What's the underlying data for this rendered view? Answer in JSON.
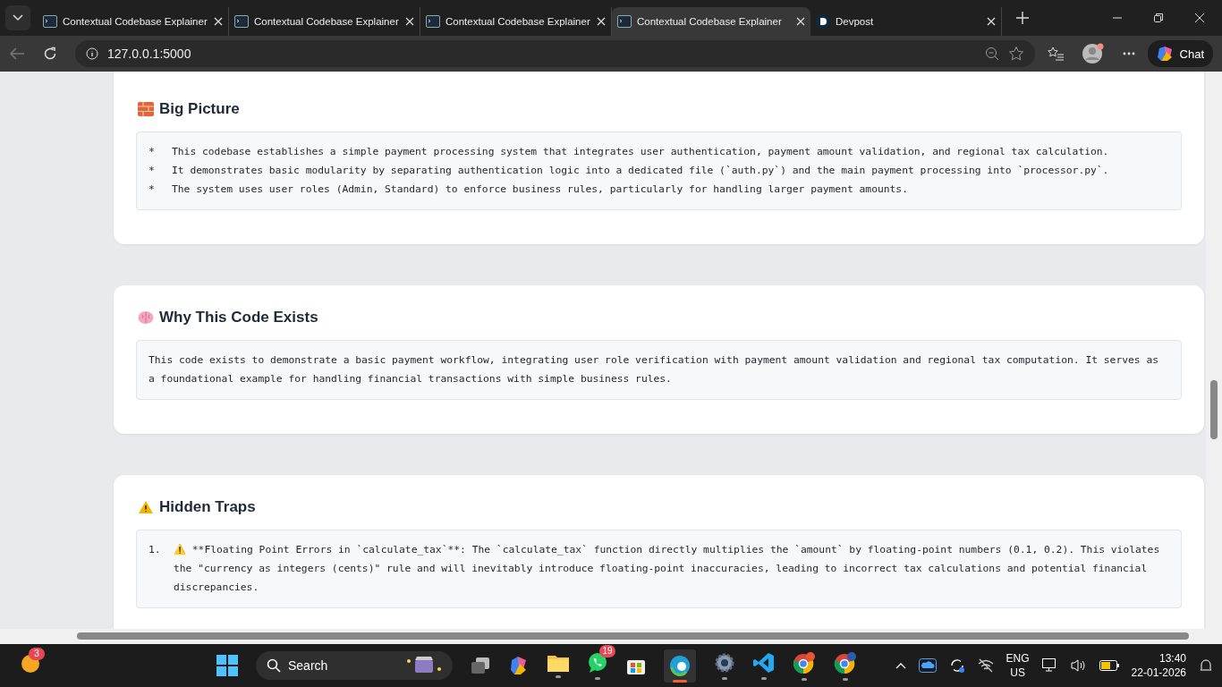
{
  "browser": {
    "tabs": [
      {
        "title": "Contextual Codebase Explainer",
        "selected": false
      },
      {
        "title": "Contextual Codebase Explainer",
        "selected": false
      },
      {
        "title": "Contextual Codebase Explainer",
        "selected": false
      },
      {
        "title": "Contextual Codebase Explainer",
        "selected": true
      },
      {
        "title": "Devpost",
        "selected": false,
        "kind": "site"
      }
    ],
    "address": "127.0.0.1:5000",
    "chat_label": "Chat"
  },
  "sections": [
    {
      "kind": "list",
      "title": "Big Picture",
      "items": [
        {
          "marker": "*",
          "text": "This codebase establishes a simple payment processing system that integrates user authentication, payment amount validation, and regional tax calculation."
        },
        {
          "marker": "*",
          "text": "It demonstrates basic modularity by separating authentication logic into a dedicated file (`auth.py`) and the main payment processing into `processor.py`."
        },
        {
          "marker": "*",
          "text": "The system uses user roles (Admin, Standard) to enforce business rules, particularly for handling larger payment amounts."
        }
      ]
    },
    {
      "kind": "paragraph",
      "title": "Why This Code Exists",
      "items": [
        {
          "text": "This code exists to demonstrate a basic payment workflow, integrating user role verification with payment amount validation and regional tax computation. It serves as a foundational example for handling financial transactions with simple business rules."
        }
      ]
    },
    {
      "kind": "warning",
      "title": "Hidden Traps",
      "items": [
        {
          "marker": "1.",
          "text": "⚠️ **Floating Point Errors in `calculate_tax`**: The `calculate_tax` function directly multiplies the `amount` by floating-point numbers (0.1, 0.2). This violates the \"currency as integers (cents)\" rule and will inevitably introduce floating-point inaccuracies, leading to incorrect tax calculations and potential financial discrepancies."
        }
      ]
    }
  ],
  "taskbar": {
    "widget_badge": "3",
    "search_placeholder": "Search",
    "whatsapp_badge": "19",
    "language": "ENG",
    "region": "US",
    "time": "13:40",
    "date": "22-01-2026"
  }
}
